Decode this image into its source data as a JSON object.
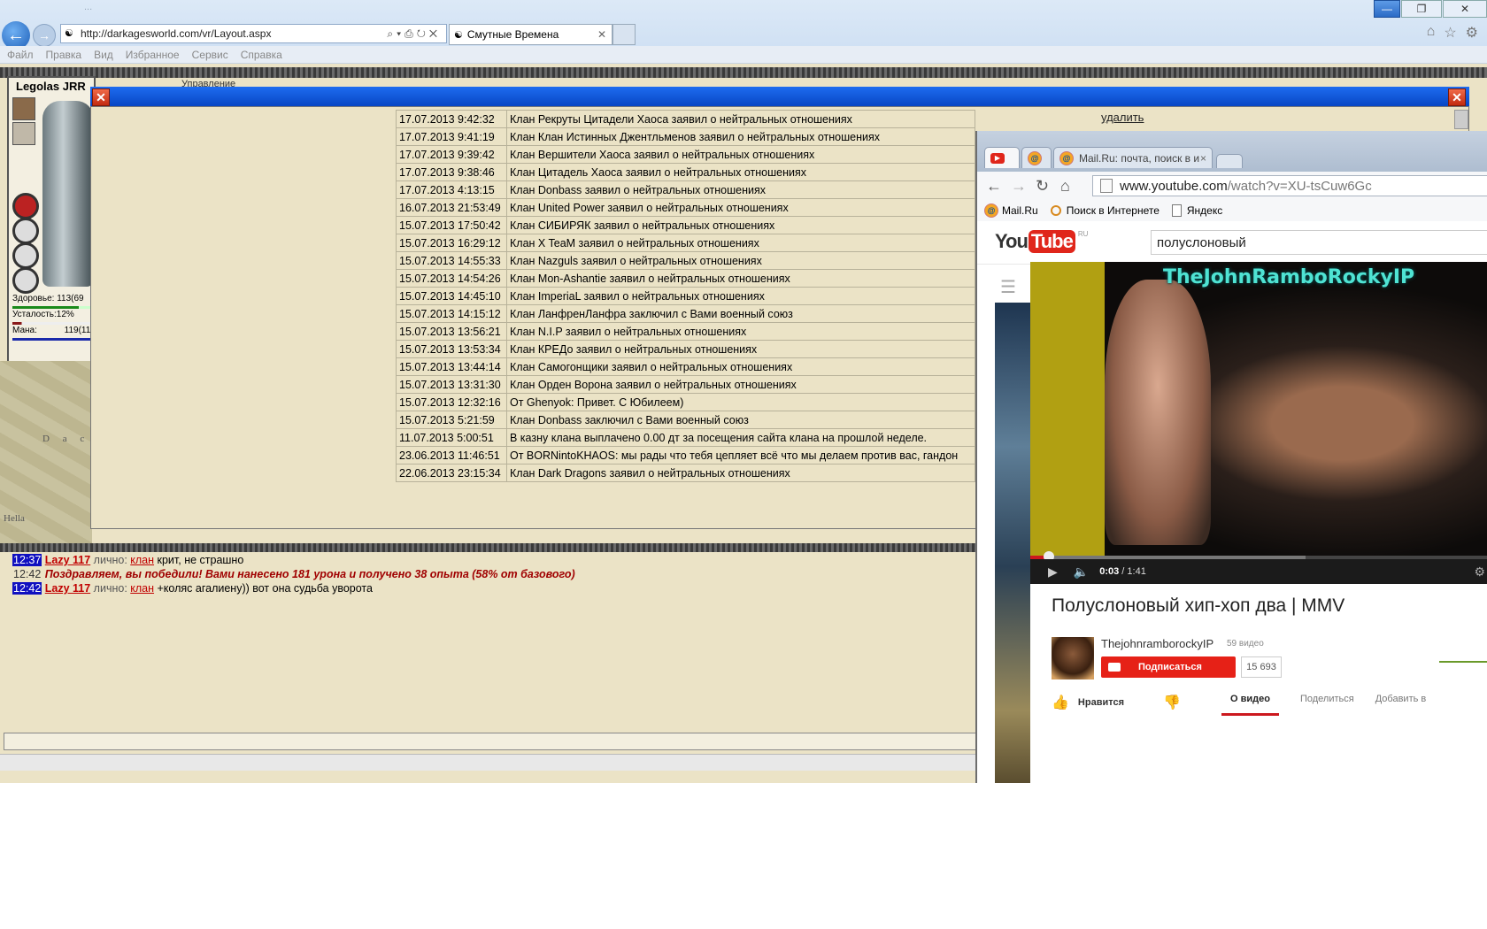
{
  "ie": {
    "title_ghost": "...",
    "url": "http://darkagesworld.com/vr/Layout.aspx",
    "tab_title": "Смутные Времена",
    "menu": [
      "Файл",
      "Правка",
      "Вид",
      "Избранное",
      "Сервис",
      "Справка"
    ]
  },
  "character": {
    "name": "Legolas JRR",
    "top_label": "Управление",
    "health_label": "Здоровье:",
    "health_value": "113(69",
    "fatigue_label": "Усталость:12%",
    "mana_label": "Мана:",
    "mana_value": "119(11",
    "map_text": "D a c l",
    "map_text2": "Hella"
  },
  "modal": {
    "close_symbol": "✕",
    "delete_link": "удалить",
    "rows": [
      {
        "time": "17.07.2013 9:42:32",
        "msg": "Клан Рекруты Цитадели Хаоса заявил о нейтральных отношениях"
      },
      {
        "time": "17.07.2013 9:41:19",
        "msg": "Клан Клан Истинных Джентльменов заявил о нейтральных отношениях"
      },
      {
        "time": "17.07.2013 9:39:42",
        "msg": "Клан Вершители Хаоса заявил о нейтральных отношениях"
      },
      {
        "time": "17.07.2013 9:38:46",
        "msg": "Клан Цитадель Хаоса заявил о нейтральных отношениях"
      },
      {
        "time": "17.07.2013 4:13:15",
        "msg": "Клан Donbass заявил о нейтральных отношениях"
      },
      {
        "time": "16.07.2013 21:53:49",
        "msg": "Клан United Power заявил о нейтральных отношениях"
      },
      {
        "time": "15.07.2013 17:50:42",
        "msg": "Клан СИБИРЯК заявил о нейтральных отношениях"
      },
      {
        "time": "15.07.2013 16:29:12",
        "msg": "Клан X TeaM заявил о нейтральных отношениях"
      },
      {
        "time": "15.07.2013 14:55:33",
        "msg": "Клан Nazguls заявил о нейтральных отношениях"
      },
      {
        "time": "15.07.2013 14:54:26",
        "msg": "Клан Mon-Ashantie заявил о нейтральных отношениях"
      },
      {
        "time": "15.07.2013 14:45:10",
        "msg": "Клан ImperiaL заявил о нейтральных отношениях"
      },
      {
        "time": "15.07.2013 14:15:12",
        "msg": "Клан ЛанфренЛанфра заключил с Вами военный союз"
      },
      {
        "time": "15.07.2013 13:56:21",
        "msg": "Клан N.I.P заявил о нейтральных отношениях"
      },
      {
        "time": "15.07.2013 13:53:34",
        "msg": "Клан КРЕДо заявил о нейтральных отношениях"
      },
      {
        "time": "15.07.2013 13:44:14",
        "msg": "Клан Самогонщики заявил о нейтральных отношениях"
      },
      {
        "time": "15.07.2013 13:31:30",
        "msg": "Клан Орден Ворона заявил о нейтральных отношениях"
      },
      {
        "time": "15.07.2013 12:32:16",
        "msg": "От Ghenyok: Привет. С Юбилеем)"
      },
      {
        "time": "15.07.2013 5:21:59",
        "msg": "Клан Donbass заключил с Вами военный союз"
      },
      {
        "time": "11.07.2013 5:00:51",
        "msg": "В казну клана выплачено 0.00 дт за посещения сайта клана на прошлой неделе."
      },
      {
        "time": "23.06.2013 11:46:51",
        "msg": "От BORNintoKHAOS: мы рады что тебя цепляет всё что мы делаем против вас, гандон"
      },
      {
        "time": "22.06.2013 23:15:34",
        "msg": "Клан Dark Dragons заявил о нейтральных отношениях"
      }
    ]
  },
  "chat": {
    "line1": {
      "time": "12:37",
      "nick": "Lazy 117",
      "private": " лично: ",
      "clan": "клан",
      "text": " крит, не страшно"
    },
    "line2": {
      "time": "12:42",
      "text": "Поздравляем, вы победили! Вами нанесено 181 урона и получено 38 опыта (58% от базового)"
    },
    "line3": {
      "time": "12:42",
      "nick": "Lazy 117",
      "private": " лично: ",
      "clan": "клан",
      "text": " +коляс агалиену)) вот она судьба уворота"
    }
  },
  "chrome": {
    "tab1": "",
    "tab3": "Mail.Ru: почта, поиск в и",
    "tab_close": "×",
    "url_host": "www.youtube.com",
    "url_path": "/watch?v=XU-tsCuw6Gc",
    "bookmarks": [
      "Mail.Ru",
      "Поиск в Интернете",
      "Яндекс"
    ]
  },
  "youtube": {
    "logo_you": "You",
    "logo_tube": "Tube",
    "logo_region": "RU",
    "search_value": "полуслоновый",
    "watermark": "TheJohnRamboRockyIP",
    "progress_played": 0.04,
    "progress_buffered": 0.6,
    "time_current": "0:03",
    "time_total": " / 1:41",
    "title": "Полуслоновый хип-хоп два | MMV",
    "channel": "ThejohnramborockyIP",
    "channel_videos": "59 видео",
    "subscribe": "Подписаться",
    "subscribers": "15 693",
    "like": "Нравится",
    "tabs": [
      "О видео",
      "Поделиться",
      "Добавить в"
    ]
  }
}
